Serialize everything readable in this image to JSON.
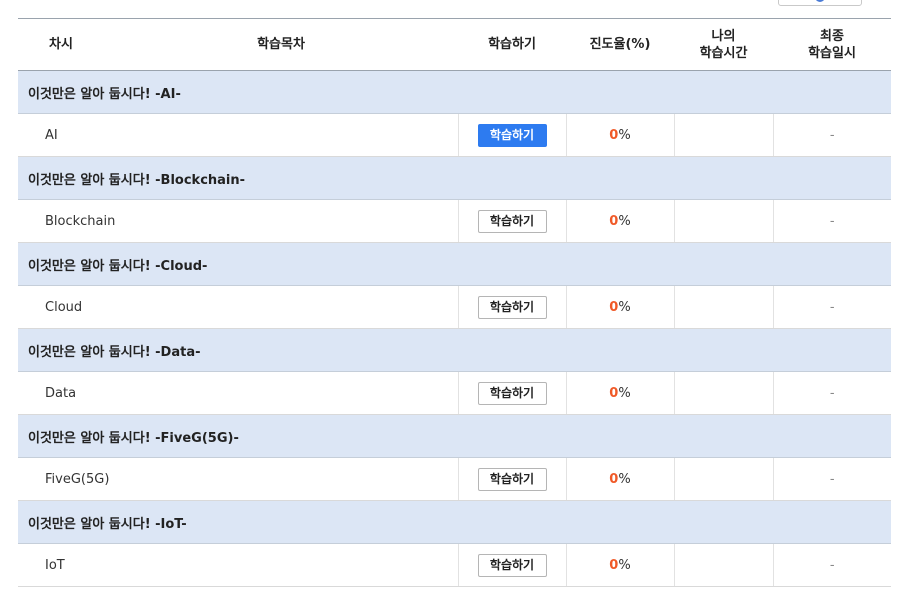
{
  "header": {
    "col_session": "차시",
    "col_contents": "학습목차",
    "col_study": "학습하기",
    "col_progress": "진도율(%)",
    "col_my_time_1": "나의",
    "col_my_time_2": "학습시간",
    "col_last_1": "최종",
    "col_last_2": "학습일시"
  },
  "sections": [
    {
      "chapter": "이것만은 알아 둡시다! -AI-",
      "lesson": {
        "title": "AI",
        "button": "학습하기",
        "progress": "0",
        "unit": "%",
        "time": "",
        "last": "-"
      }
    },
    {
      "chapter": "이것만은 알아 둡시다! -Blockchain-",
      "lesson": {
        "title": "Blockchain",
        "button": "학습하기",
        "progress": "0",
        "unit": "%",
        "time": "",
        "last": "-"
      }
    },
    {
      "chapter": "이것만은 알아 둡시다! -Cloud-",
      "lesson": {
        "title": "Cloud",
        "button": "학습하기",
        "progress": "0",
        "unit": "%",
        "time": "",
        "last": "-"
      }
    },
    {
      "chapter": "이것만은 알아 둡시다! -Data-",
      "lesson": {
        "title": "Data",
        "button": "학습하기",
        "progress": "0",
        "unit": "%",
        "time": "",
        "last": "-"
      }
    },
    {
      "chapter": "이것만은 알아 둡시다! -FiveG(5G)-",
      "lesson": {
        "title": "FiveG(5G)",
        "button": "학습하기",
        "progress": "0",
        "unit": "%",
        "time": "",
        "last": "-"
      }
    },
    {
      "chapter": "이것만은 알아 둡시다! -IoT-",
      "lesson": {
        "title": "IoT",
        "button": "학습하기",
        "progress": "0",
        "unit": "%",
        "time": "",
        "last": "-"
      }
    }
  ],
  "colors": {
    "active_button": "#2d7bf0",
    "chapter_bg": "#dce6f5",
    "progress_number": "#f05a28"
  }
}
